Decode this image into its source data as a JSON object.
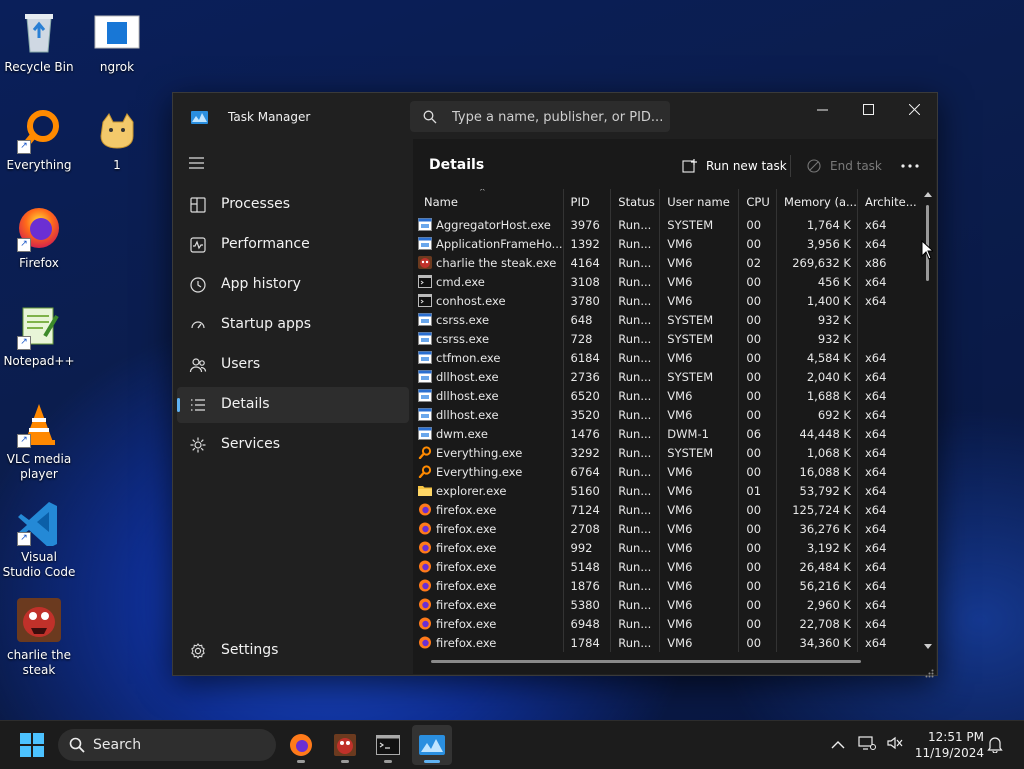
{
  "desktop": {
    "icons": [
      {
        "label": "Recycle Bin",
        "icon": "recycle-bin-icon"
      },
      {
        "label": "ngrok",
        "icon": "ngrok-icon"
      },
      {
        "label": "Everything",
        "icon": "everything-icon"
      },
      {
        "label": "1",
        "icon": "cat-image-icon"
      },
      {
        "label": "Firefox",
        "icon": "firefox-icon"
      },
      {
        "label": "Notepad++",
        "icon": "notepad-plus-plus-icon"
      },
      {
        "label": "VLC media player",
        "icon": "vlc-icon"
      },
      {
        "label": "Visual Studio Code",
        "icon": "vscode-icon"
      },
      {
        "label": "charlie the steak",
        "icon": "charlie-the-steak-icon"
      }
    ]
  },
  "window": {
    "title": "Task Manager",
    "search_placeholder": "Type a name, publisher, or PID..."
  },
  "sidebar": {
    "items": [
      {
        "label": "Processes",
        "icon": "processes-icon"
      },
      {
        "label": "Performance",
        "icon": "performance-icon"
      },
      {
        "label": "App history",
        "icon": "app-history-icon"
      },
      {
        "label": "Startup apps",
        "icon": "startup-apps-icon"
      },
      {
        "label": "Users",
        "icon": "users-icon"
      },
      {
        "label": "Details",
        "icon": "details-icon",
        "active": true
      },
      {
        "label": "Services",
        "icon": "services-icon"
      }
    ],
    "settings_label": "Settings"
  },
  "details": {
    "title": "Details",
    "run_new_task": "Run new task",
    "end_task": "End task",
    "columns": [
      "Name",
      "PID",
      "Status",
      "User name",
      "CPU",
      "Memory (a...",
      "Archite..."
    ],
    "rows": [
      {
        "name": "AggregatorHost.exe",
        "pid": "3976",
        "status": "Run...",
        "user": "SYSTEM",
        "cpu": "00",
        "mem": "1,764 K",
        "arch": "x64",
        "icon": "window-app"
      },
      {
        "name": "ApplicationFrameHo...",
        "pid": "1392",
        "status": "Run...",
        "user": "VM6",
        "cpu": "00",
        "mem": "3,956 K",
        "arch": "x64",
        "icon": "window-app"
      },
      {
        "name": "charlie the steak.exe",
        "pid": "4164",
        "status": "Run...",
        "user": "VM6",
        "cpu": "02",
        "mem": "269,632 K",
        "arch": "x86",
        "icon": "charlie"
      },
      {
        "name": "cmd.exe",
        "pid": "3108",
        "status": "Run...",
        "user": "VM6",
        "cpu": "00",
        "mem": "456 K",
        "arch": "x64",
        "icon": "console"
      },
      {
        "name": "conhost.exe",
        "pid": "3780",
        "status": "Run...",
        "user": "VM6",
        "cpu": "00",
        "mem": "1,400 K",
        "arch": "x64",
        "icon": "console"
      },
      {
        "name": "csrss.exe",
        "pid": "648",
        "status": "Run...",
        "user": "SYSTEM",
        "cpu": "00",
        "mem": "932 K",
        "arch": "",
        "icon": "window-app"
      },
      {
        "name": "csrss.exe",
        "pid": "728",
        "status": "Run...",
        "user": "SYSTEM",
        "cpu": "00",
        "mem": "932 K",
        "arch": "",
        "icon": "window-app"
      },
      {
        "name": "ctfmon.exe",
        "pid": "6184",
        "status": "Run...",
        "user": "VM6",
        "cpu": "00",
        "mem": "4,584 K",
        "arch": "x64",
        "icon": "window-app"
      },
      {
        "name": "dllhost.exe",
        "pid": "2736",
        "status": "Run...",
        "user": "SYSTEM",
        "cpu": "00",
        "mem": "2,040 K",
        "arch": "x64",
        "icon": "window-app"
      },
      {
        "name": "dllhost.exe",
        "pid": "6520",
        "status": "Run...",
        "user": "VM6",
        "cpu": "00",
        "mem": "1,688 K",
        "arch": "x64",
        "icon": "window-app"
      },
      {
        "name": "dllhost.exe",
        "pid": "3520",
        "status": "Run...",
        "user": "VM6",
        "cpu": "00",
        "mem": "692 K",
        "arch": "x64",
        "icon": "window-app"
      },
      {
        "name": "dwm.exe",
        "pid": "1476",
        "status": "Run...",
        "user": "DWM-1",
        "cpu": "06",
        "mem": "44,448 K",
        "arch": "x64",
        "icon": "window-app"
      },
      {
        "name": "Everything.exe",
        "pid": "3292",
        "status": "Run...",
        "user": "SYSTEM",
        "cpu": "00",
        "mem": "1,068 K",
        "arch": "x64",
        "icon": "everything"
      },
      {
        "name": "Everything.exe",
        "pid": "6764",
        "status": "Run...",
        "user": "VM6",
        "cpu": "00",
        "mem": "16,088 K",
        "arch": "x64",
        "icon": "everything"
      },
      {
        "name": "explorer.exe",
        "pid": "5160",
        "status": "Run...",
        "user": "VM6",
        "cpu": "01",
        "mem": "53,792 K",
        "arch": "x64",
        "icon": "folder"
      },
      {
        "name": "firefox.exe",
        "pid": "7124",
        "status": "Run...",
        "user": "VM6",
        "cpu": "00",
        "mem": "125,724 K",
        "arch": "x64",
        "icon": "firefox"
      },
      {
        "name": "firefox.exe",
        "pid": "2708",
        "status": "Run...",
        "user": "VM6",
        "cpu": "00",
        "mem": "36,276 K",
        "arch": "x64",
        "icon": "firefox"
      },
      {
        "name": "firefox.exe",
        "pid": "992",
        "status": "Run...",
        "user": "VM6",
        "cpu": "00",
        "mem": "3,192 K",
        "arch": "x64",
        "icon": "firefox"
      },
      {
        "name": "firefox.exe",
        "pid": "5148",
        "status": "Run...",
        "user": "VM6",
        "cpu": "00",
        "mem": "26,484 K",
        "arch": "x64",
        "icon": "firefox"
      },
      {
        "name": "firefox.exe",
        "pid": "1876",
        "status": "Run...",
        "user": "VM6",
        "cpu": "00",
        "mem": "56,216 K",
        "arch": "x64",
        "icon": "firefox"
      },
      {
        "name": "firefox.exe",
        "pid": "5380",
        "status": "Run...",
        "user": "VM6",
        "cpu": "00",
        "mem": "2,960 K",
        "arch": "x64",
        "icon": "firefox"
      },
      {
        "name": "firefox.exe",
        "pid": "6948",
        "status": "Run...",
        "user": "VM6",
        "cpu": "00",
        "mem": "22,708 K",
        "arch": "x64",
        "icon": "firefox"
      },
      {
        "name": "firefox.exe",
        "pid": "1784",
        "status": "Run...",
        "user": "VM6",
        "cpu": "00",
        "mem": "34,360 K",
        "arch": "x64",
        "icon": "firefox"
      }
    ]
  },
  "taskbar": {
    "search_label": "Search",
    "time": "12:51 PM",
    "date": "11/19/2024"
  },
  "colors": {
    "accent": "#5fb2f2",
    "window_bg": "#202020",
    "content_bg": "#191919"
  }
}
